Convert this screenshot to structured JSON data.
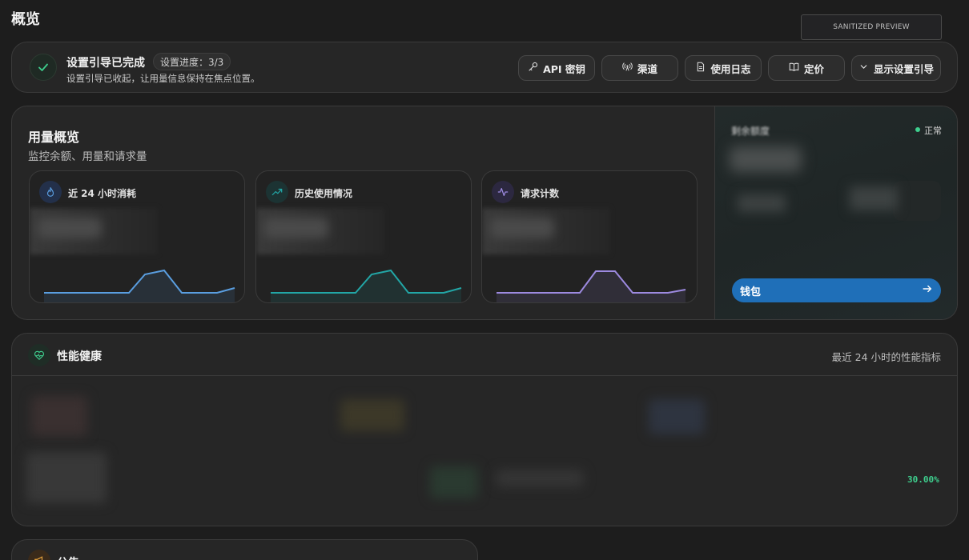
{
  "page": {
    "title": "概览",
    "preview_label": "SANITIZED PREVIEW"
  },
  "setup": {
    "title": "设置引导已完成",
    "progress": "设置进度：3/3",
    "subtitle": "设置引导已收起，让用量信息保持在焦点位置。",
    "buttons": [
      {
        "label": "API 密钥",
        "icon": "key-icon"
      },
      {
        "label": "渠道",
        "icon": "broadcast-icon"
      },
      {
        "label": "使用日志",
        "icon": "document-icon"
      },
      {
        "label": "定价",
        "icon": "book-icon"
      },
      {
        "label": "显示设置引导",
        "icon": "chevron-down-icon"
      }
    ]
  },
  "usage": {
    "title": "用量概览",
    "subtitle": "监控余额、用量和请求量",
    "cards": [
      {
        "label": "近 24 小时消耗",
        "icon": "flame-icon",
        "color": "#5a9ee0"
      },
      {
        "label": "历史使用情况",
        "icon": "trending-up-icon",
        "color": "#22a6a6"
      },
      {
        "label": "请求计数",
        "icon": "activity-icon",
        "color": "#9d8ae0"
      }
    ],
    "right": {
      "remain_label": "剩余额度",
      "status": "正常",
      "wallet_label": "钱包"
    }
  },
  "performance": {
    "title": "性能健康",
    "note": "最近 24 小时的性能指标",
    "percent": "30.00%"
  },
  "notice": {
    "title": "公告"
  },
  "colors": {
    "accent_green": "#3ecf8e",
    "wallet_blue": "#1f6fb8"
  }
}
